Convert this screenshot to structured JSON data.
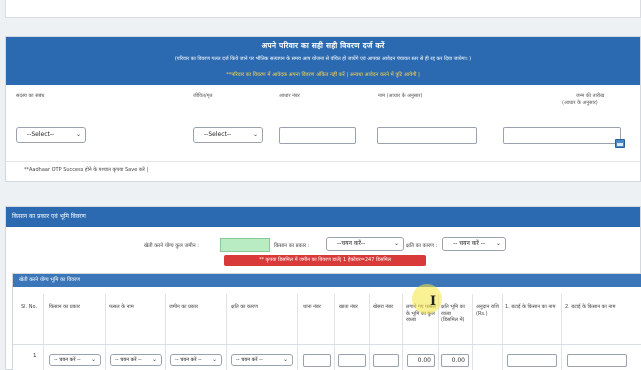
{
  "family": {
    "title": "अपने परिवार का सही सही विवरण दर्ज करें",
    "subtitle": "(परिवार का विवरण गलत दर्ज किये जाने पर भौतिक सत्यापन के समय आप योजना से वंचित हो जायेंगे एवं आपका आवेदन पंचायत स्तर से ही रद्द कर दिया जायेगा। )",
    "warning": "**परिवार का विवरण में आवेदक अपना विवरण अंकित नहीं करें | अन्यथा आवेदन करने में त्रुटि आयेगी |",
    "col_relation": "सदस्य का संबंध",
    "col_alive": "जीवित/मृत",
    "col_aadhaar": "आधार नंबर",
    "col_name": "नाम (आधार के अनुसार)",
    "col_dob": "जन्म की तारीख",
    "col_dob_note": "(आधार के अनुसार)",
    "relation_select": "--Select--",
    "alive_select": "--Select--",
    "otp_note": "**Aadhaar OTP Success होने के पश्चात कृपया Save करें |"
  },
  "kisan": {
    "title": "किसान का प्रकार एवं भूमि विवरण",
    "label_total_land": "खेती करने योग्य कुल जमीन :",
    "label_farmer_type": "किसान का प्रकार :",
    "farmer_type_select": "--चयन करें--",
    "label_loss_reason": "क्षति का कारण :",
    "loss_reason_select": "-- चयन करें --",
    "alert": "** कृपया डिसमिल में जमीन का विवरण डालें| 1 हेक्टेयर=247 डिसमिल",
    "sub_title": "खेती करने योग्य भूमि का विवरण",
    "headers": {
      "sl": "Sl. No.",
      "farmer_type": "किसान का प्रकार",
      "crop_name": "फसल के नाम",
      "land_type": "जमीन का प्रकार",
      "loss_reason": "क्षति का कारण",
      "thana": "थाना नंबर",
      "khata": "खाता नंबर",
      "khesra": "खेसरा नंबर",
      "total_land": "लगाये गए फसल के भूमि का कुल रकबा",
      "damaged_land": "क्षति भूमि का रकबा (डिसमिल में)",
      "grant": "अनुदान राशि (Rs.)",
      "farmer1": "1. बटाई के किसान का नाम",
      "farmer2": "2. बटाई के किसान का नाम"
    },
    "row": {
      "sno": "1",
      "select_label": "-- चयन करें --",
      "total_value": "0.00",
      "damaged_value": "0.00"
    }
  },
  "cursor": "I"
}
